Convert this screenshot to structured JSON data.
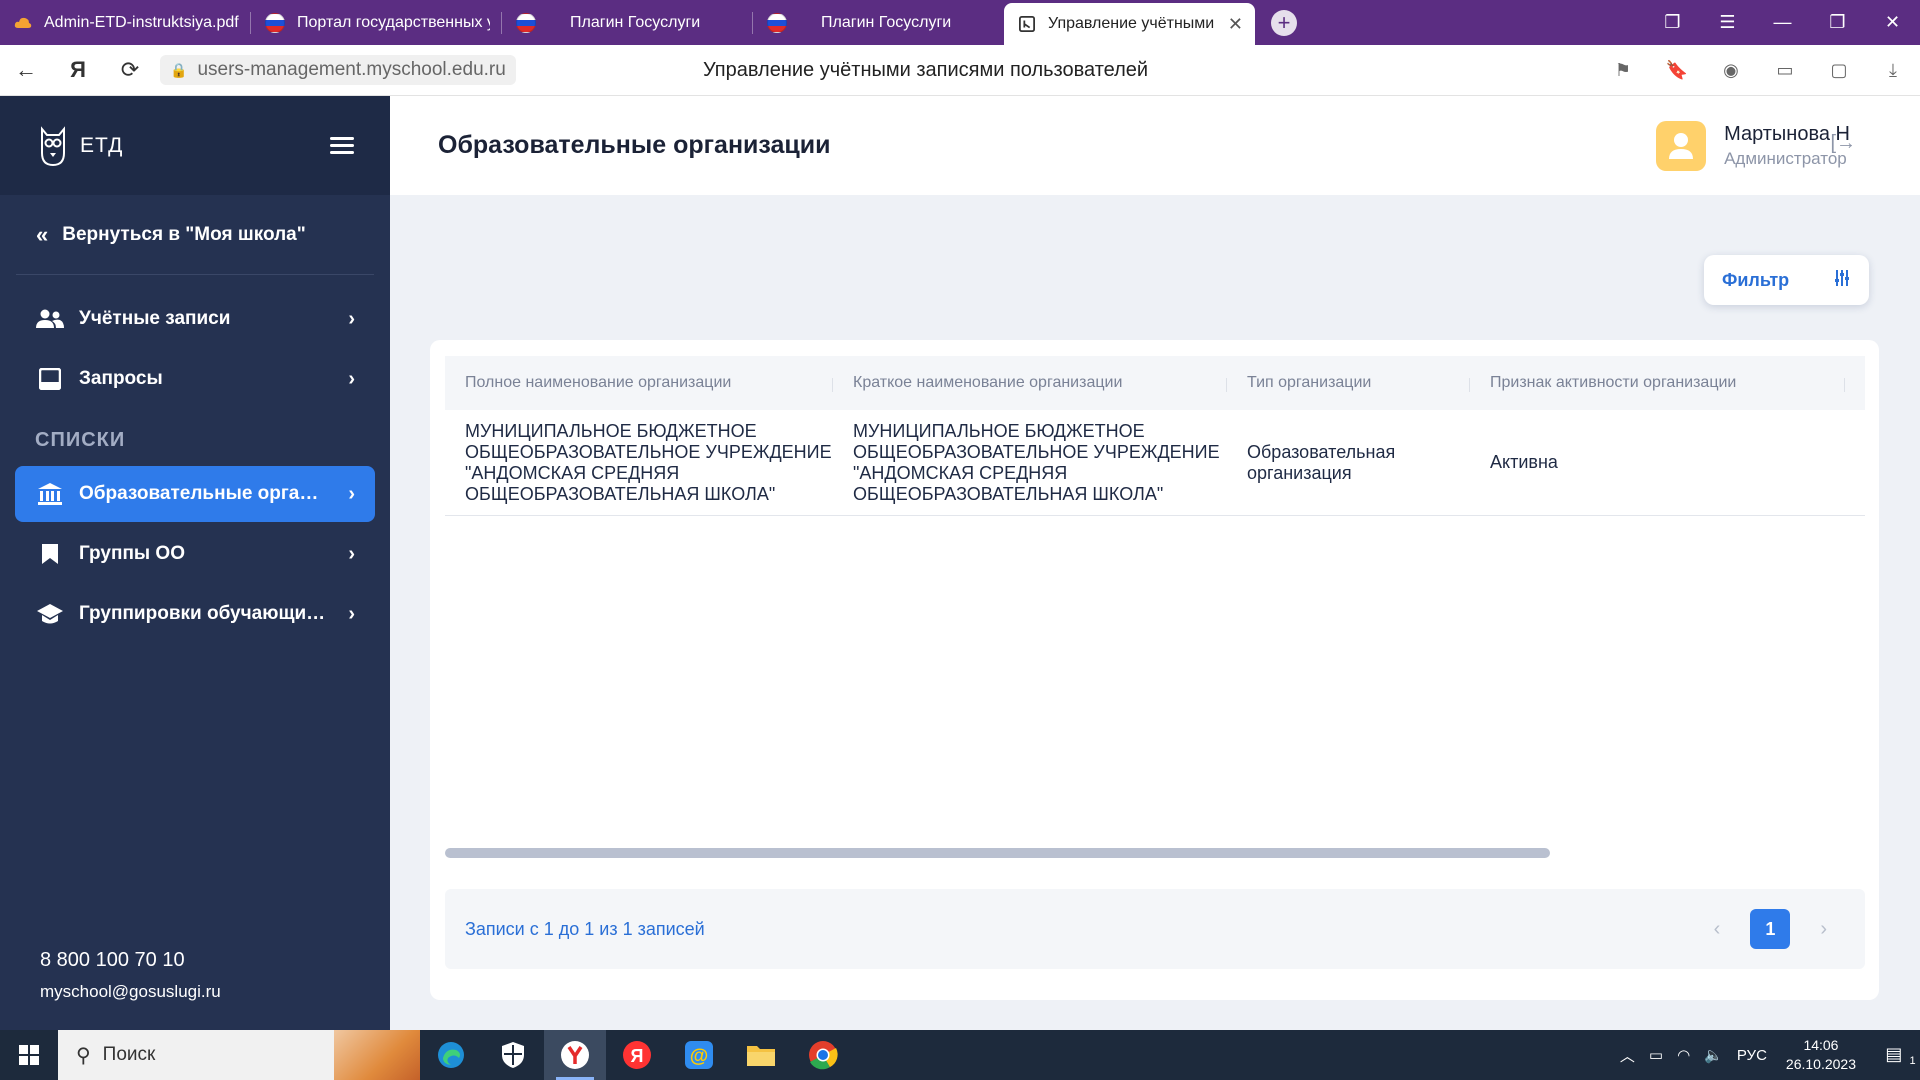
{
  "browser": {
    "tabs": [
      {
        "label": "Admin-ETD-instruktsiya.pdf",
        "icon": "pdf-cloud-icon",
        "active": false
      },
      {
        "label": "Портал государственных у",
        "icon": "russia-flag-icon",
        "active": false
      },
      {
        "label": "Плагин Госуслуги",
        "icon": "russia-flag-icon",
        "active": false
      },
      {
        "label": "Плагин Госуслуги",
        "icon": "russia-flag-icon",
        "active": false
      },
      {
        "label": "Управление учётными",
        "icon": "etd-icon",
        "active": true
      }
    ],
    "url": "users-management.myschool.edu.ru",
    "page_title": "Управление учётными записями пользователей"
  },
  "sidebar": {
    "brand": "ЕТД",
    "back_label": "Вернуться в \"Моя школа\"",
    "items_top": [
      {
        "label": "Учётные записи",
        "icon": "users-icon"
      },
      {
        "label": "Запросы",
        "icon": "inbox-icon"
      }
    ],
    "section_label": "СПИСКИ",
    "items_lists": [
      {
        "label": "Образовательные организа...",
        "icon": "institution-icon",
        "active": true
      },
      {
        "label": "Группы ОО",
        "icon": "bookmark-icon",
        "active": false
      },
      {
        "label": "Группировки обучающихся",
        "icon": "graduation-cap-icon",
        "active": false
      }
    ],
    "phone": "8 800 100 70 10",
    "email": "myschool@gosuslugi.ru"
  },
  "header": {
    "title": "Образовательные организации",
    "user_name": "Мартынова Н",
    "user_role": "Администратор"
  },
  "filter": {
    "label": "Фильтр"
  },
  "table": {
    "columns": [
      "Полное наименование организации",
      "Краткое наименование организации",
      "Тип организации",
      "Признак активности организации"
    ],
    "rows": [
      {
        "full_name": "МУНИЦИПАЛЬНОЕ БЮДЖЕТНОЕ ОБЩЕОБРАЗОВАТЕЛЬНОЕ УЧРЕЖДЕНИЕ \"АНДОМСКАЯ СРЕДНЯЯ ОБЩЕОБРАЗОВАТЕЛЬНАЯ ШКОЛА\"",
        "short_name": "МУНИЦИПАЛЬНОЕ БЮДЖЕТНОЕ ОБЩЕОБРАЗОВАТЕЛЬНОЕ УЧРЕЖДЕНИЕ \"АНДОМСКАЯ СРЕДНЯЯ ОБЩЕОБРАЗОВАТЕЛЬНАЯ ШКОЛА\"",
        "type": "Образовательная организация",
        "status": "Активна"
      }
    ]
  },
  "pagination": {
    "summary": "Записи с 1 до 1 из 1 записей",
    "current_page": "1"
  },
  "taskbar": {
    "search_placeholder": "Поиск",
    "language": "РУС",
    "time": "14:06",
    "date": "26.10.2023",
    "notification_count": "1"
  },
  "colors": {
    "sidebar_bg": "#253251",
    "accent": "#2f7bea",
    "tabbar_bg": "#5b2d82"
  }
}
